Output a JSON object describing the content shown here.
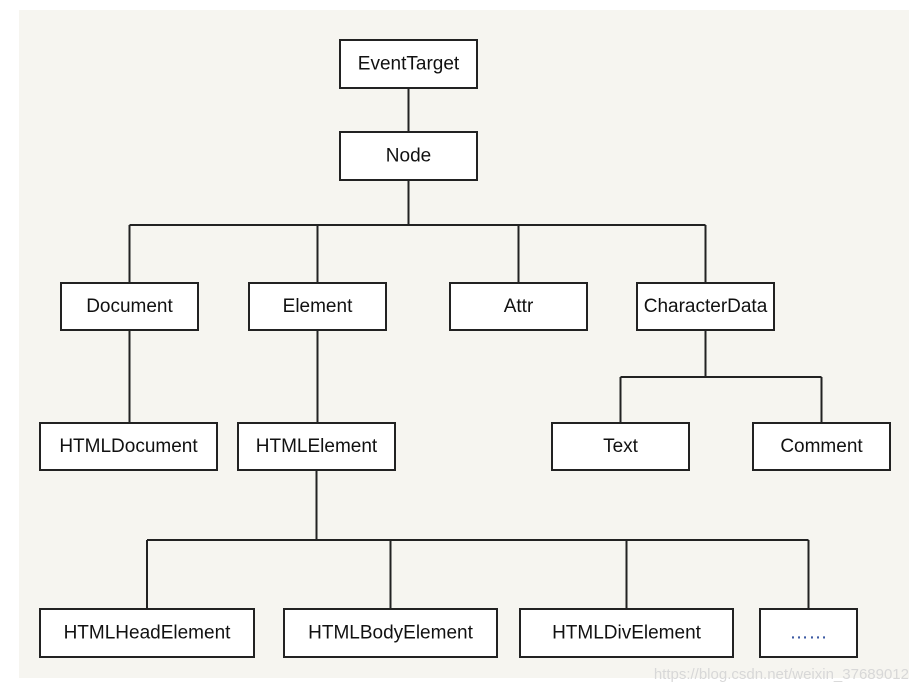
{
  "nodes": {
    "eventtarget": "EventTarget",
    "node": "Node",
    "document": "Document",
    "element": "Element",
    "attr": "Attr",
    "characterdata": "CharacterData",
    "htmldocument": "HTMLDocument",
    "htmlelement": "HTMLElement",
    "text": "Text",
    "comment": "Comment",
    "htmlheadelement": "HTMLHeadElement",
    "htmlbodyelement": "HTMLBodyElement",
    "htmldivelement": "HTMLDivElement",
    "more": "……"
  },
  "edges": [
    [
      "eventtarget",
      "node"
    ],
    [
      "node",
      "document"
    ],
    [
      "node",
      "element"
    ],
    [
      "node",
      "attr"
    ],
    [
      "node",
      "characterdata"
    ],
    [
      "document",
      "htmldocument"
    ],
    [
      "element",
      "htmlelement"
    ],
    [
      "characterdata",
      "text"
    ],
    [
      "characterdata",
      "comment"
    ],
    [
      "htmlelement",
      "htmlheadelement"
    ],
    [
      "htmlelement",
      "htmlbodyelement"
    ],
    [
      "htmlelement",
      "htmldivelement"
    ],
    [
      "htmlelement",
      "more"
    ]
  ],
  "watermark": "https://blog.csdn.net/weixin_37689012"
}
